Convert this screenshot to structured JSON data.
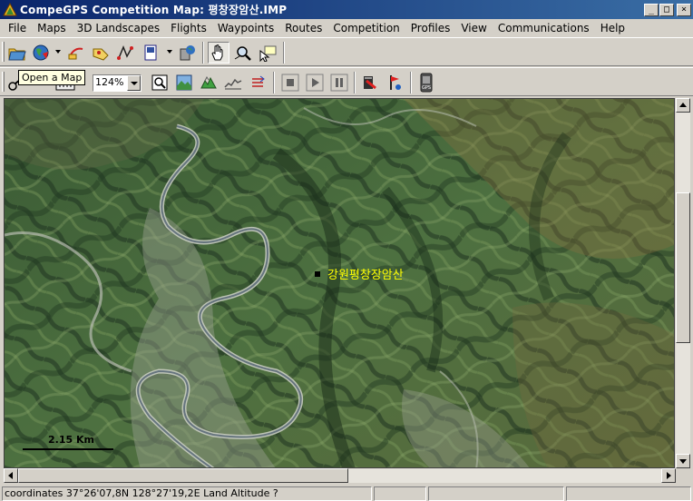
{
  "window": {
    "title": "CompeGPS Competition Map: 평창장암산.IMP",
    "controls": {
      "minimize": "_",
      "maximize": "□",
      "close": "×"
    }
  },
  "menu": {
    "items": [
      "File",
      "Maps",
      "3D Landscapes",
      "Flights",
      "Waypoints",
      "Routes",
      "Competition",
      "Profiles",
      "View",
      "Communications",
      "Help"
    ]
  },
  "toolbar1": {
    "icons": [
      "open-map-icon",
      "globe-icon",
      "flight-icon",
      "waypoints-icon",
      "route-icon",
      "document-icon",
      "gps-icon",
      "hand-pan-icon",
      "magnifier-icon",
      "pointer-note-icon"
    ]
  },
  "toolbar2": {
    "zoom_value": "124%",
    "icons": [
      "measure-icon",
      "zoom-fit-icon",
      "landscape-3d-icon",
      "terrain-icon",
      "profile-icon",
      "arrows-icon",
      "stop-icon",
      "play-icon",
      "pause-icon",
      "record-icon",
      "marker-icon",
      "gps-device-icon"
    ]
  },
  "tooltip": {
    "text": "Open a Map"
  },
  "map": {
    "place_label": "강원평창장암산",
    "scale_label": "2.15 Km"
  },
  "status": {
    "coordinates": "coordinates 37°26'07,8N 128°27'19,2E Land Altitude ?",
    "pane2": "",
    "pane3": "",
    "pane4": ""
  },
  "colors": {
    "title_start": "#0a246a",
    "title_end": "#3a6ea5",
    "chrome": "#d4d0c8",
    "label_yellow": "#ffff00"
  }
}
